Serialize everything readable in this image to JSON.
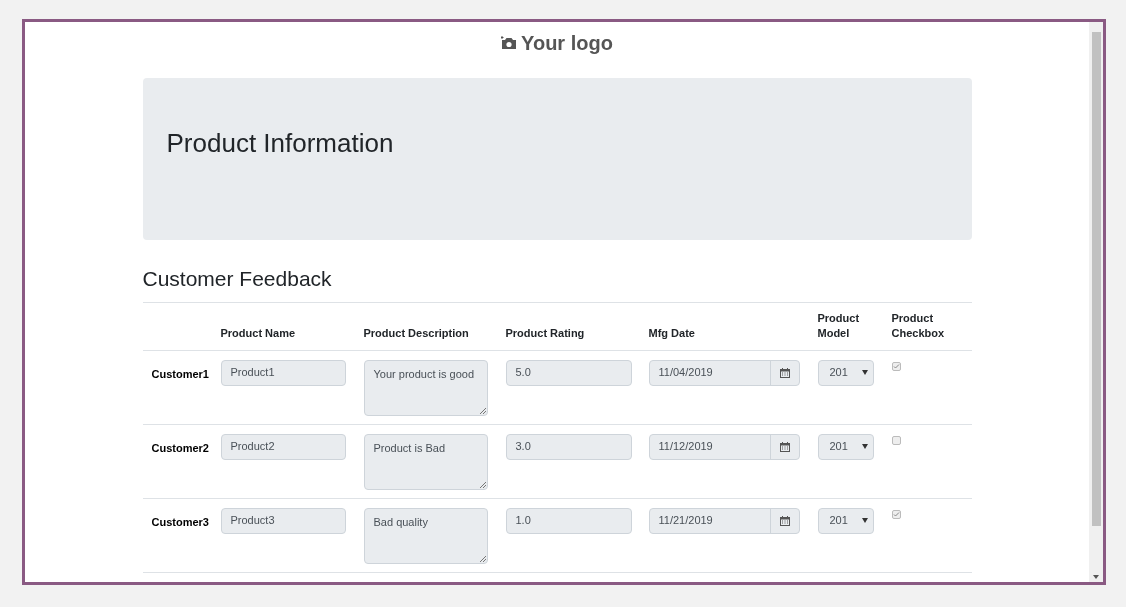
{
  "logo": {
    "text": "Your logo"
  },
  "jumbotron": {
    "title": "Product Information"
  },
  "section": {
    "title": "Customer Feedback"
  },
  "table": {
    "columns": [
      "Product Name",
      "Product Description",
      "Product Rating",
      "Mfg Date",
      "Product Model",
      "Product Checkbox"
    ],
    "rows": [
      {
        "customer": "Customer1",
        "name": "Product1",
        "description": "Your product is good",
        "rating": "5.0",
        "date": "11/04/2019",
        "model": "201",
        "checked": true
      },
      {
        "customer": "Customer2",
        "name": "Product2",
        "description": "Product is Bad",
        "rating": "3.0",
        "date": "11/12/2019",
        "model": "201",
        "checked": false
      },
      {
        "customer": "Customer3",
        "name": "Product3",
        "description": "Bad quality",
        "rating": "1.0",
        "date": "11/21/2019",
        "model": "201",
        "checked": true
      }
    ]
  }
}
